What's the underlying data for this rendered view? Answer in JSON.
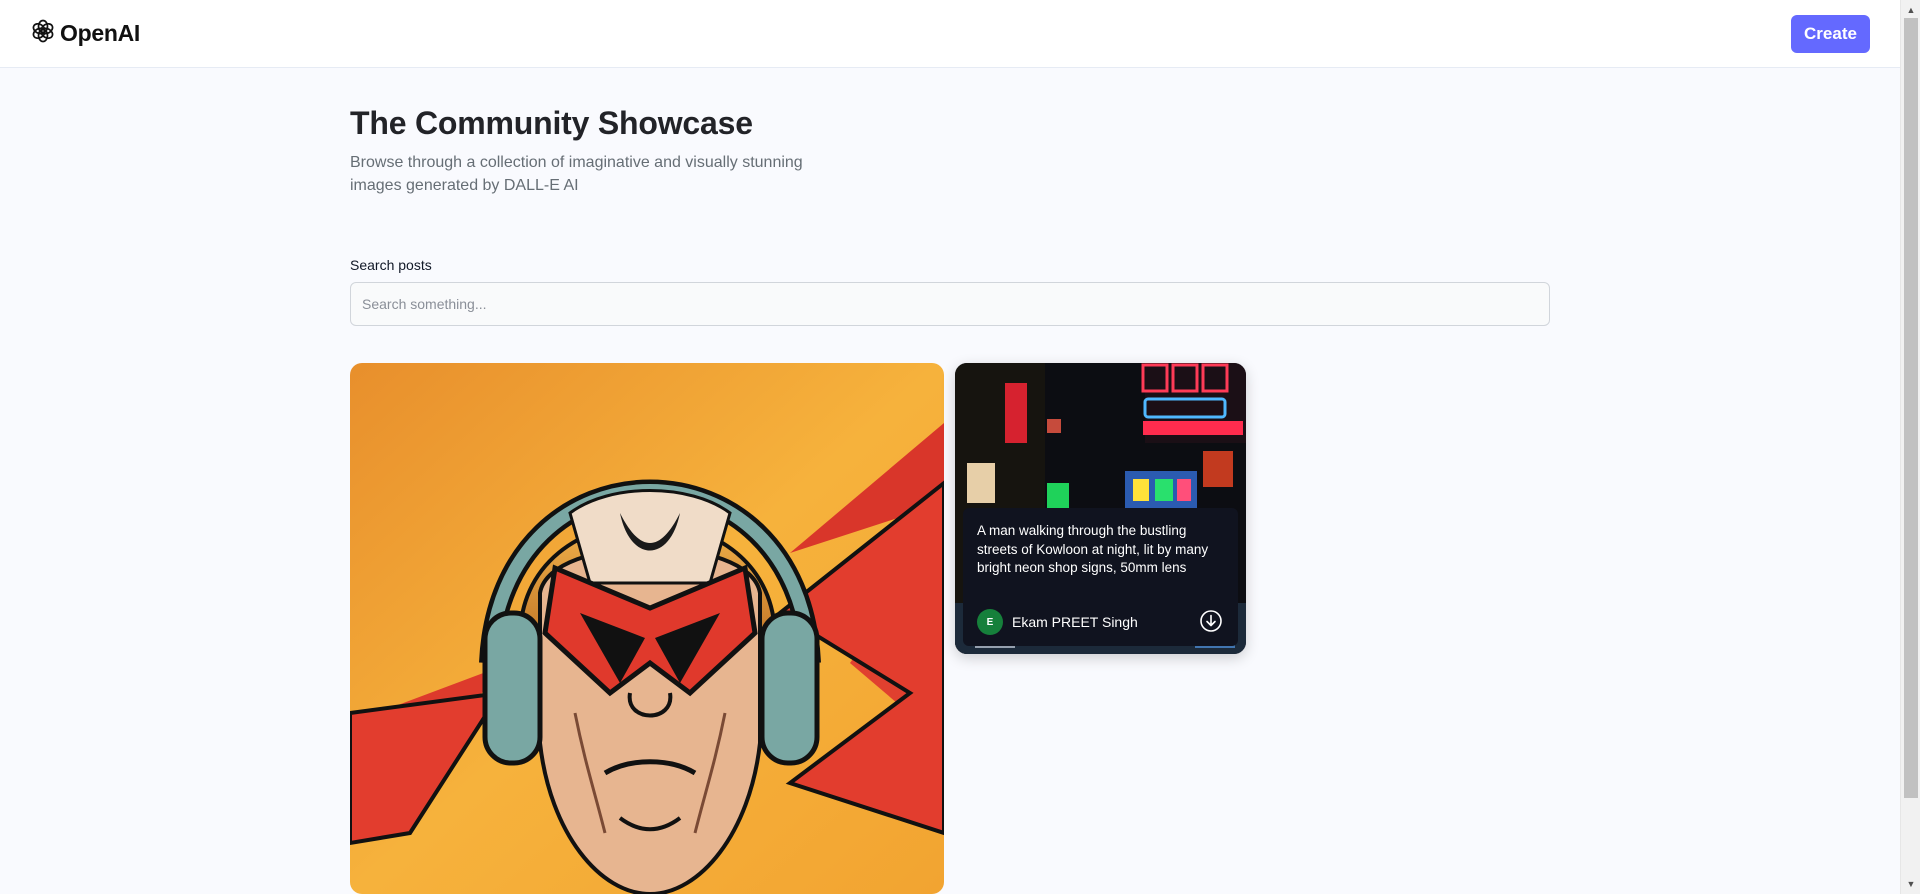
{
  "header": {
    "logo_text": "OpenAI",
    "create_label": "Create",
    "accent_color": "#6469ff"
  },
  "hero": {
    "title": "The Community Showcase",
    "subtitle": "Browse through a collection of imaginative and visually stunning images generated by DALL-E AI"
  },
  "search": {
    "label": "Search posts",
    "placeholder": "Search something...",
    "value": ""
  },
  "posts": [
    {
      "image": "comic-superhero-with-headphones",
      "prompt": "",
      "author": "",
      "avatar_initial": ""
    },
    {
      "image": "kowloon-neon-street-night",
      "prompt": "A man walking through the bustling streets of Kowloon at night, lit by many bright neon shop signs, 50mm lens",
      "author": "Ekam PREET Singh",
      "avatar_initial": "E",
      "avatar_color": "#16803b"
    }
  ],
  "icons": {
    "logo": "openai-logo-icon",
    "download": "download-icon"
  }
}
